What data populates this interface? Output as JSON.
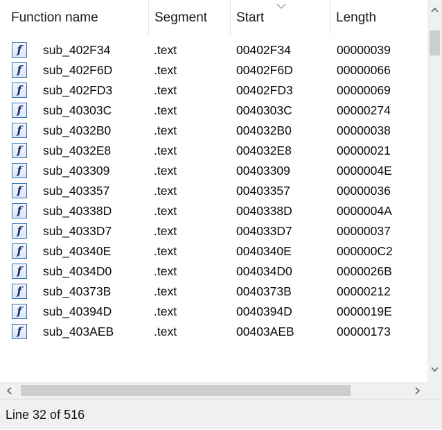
{
  "columns": {
    "function_name": "Function name",
    "segment": "Segment",
    "start": "Start",
    "length": "Length"
  },
  "rows": [
    {
      "name": "sub_402F34",
      "segment": ".text",
      "start": "00402F34",
      "length": "00000039"
    },
    {
      "name": "sub_402F6D",
      "segment": ".text",
      "start": "00402F6D",
      "length": "00000066"
    },
    {
      "name": "sub_402FD3",
      "segment": ".text",
      "start": "00402FD3",
      "length": "00000069"
    },
    {
      "name": "sub_40303C",
      "segment": ".text",
      "start": "0040303C",
      "length": "00000274"
    },
    {
      "name": "sub_4032B0",
      "segment": ".text",
      "start": "004032B0",
      "length": "00000038"
    },
    {
      "name": "sub_4032E8",
      "segment": ".text",
      "start": "004032E8",
      "length": "00000021"
    },
    {
      "name": "sub_403309",
      "segment": ".text",
      "start": "00403309",
      "length": "0000004E"
    },
    {
      "name": "sub_403357",
      "segment": ".text",
      "start": "00403357",
      "length": "00000036"
    },
    {
      "name": "sub_40338D",
      "segment": ".text",
      "start": "0040338D",
      "length": "0000004A"
    },
    {
      "name": "sub_4033D7",
      "segment": ".text",
      "start": "004033D7",
      "length": "00000037"
    },
    {
      "name": "sub_40340E",
      "segment": ".text",
      "start": "0040340E",
      "length": "000000C2"
    },
    {
      "name": "sub_4034D0",
      "segment": ".text",
      "start": "004034D0",
      "length": "0000026B"
    },
    {
      "name": "sub_40373B",
      "segment": ".text",
      "start": "0040373B",
      "length": "00000212"
    },
    {
      "name": "sub_40394D",
      "segment": ".text",
      "start": "0040394D",
      "length": "0000019E"
    },
    {
      "name": "sub_403AEB",
      "segment": ".text",
      "start": "00403AEB",
      "length": "00000173"
    }
  ],
  "function_icon": {
    "glyph": "f",
    "icon_name": "function-icon",
    "border_color": "#2f6fb3"
  },
  "sort_indicator_icon": "chevron-down-icon",
  "status": {
    "text": "Line 32 of 516"
  },
  "scrollbars": {
    "vertical_position": 0.06,
    "horizontal_visible_fraction": 0.84
  }
}
